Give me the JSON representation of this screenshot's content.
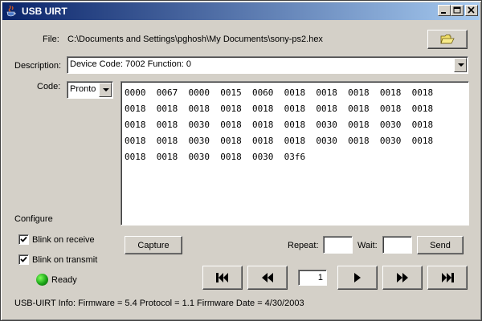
{
  "window": {
    "title": "USB UIRT",
    "minimize": "_",
    "maximize": "□",
    "close": "×"
  },
  "file": {
    "label": "File:",
    "path": "C:\\Documents and Settings\\pghosh\\My Documents\\sony-ps2.hex",
    "browse_icon": "folder-icon"
  },
  "description": {
    "label": "Description:",
    "value": "Device Code: 7002 Function: 0"
  },
  "code": {
    "label": "Code:",
    "format": "Pronto",
    "text": "0000  0067  0000  0015  0060  0018  0018  0018  0018  0018\n0018  0018  0018  0018  0018  0018  0018  0018  0018  0018\n0018  0018  0030  0018  0018  0018  0030  0018  0030  0018\n0018  0018  0030  0018  0018  0018  0030  0018  0030  0018\n0018  0018  0030  0018  0030  03f6"
  },
  "configure": {
    "label": "Configure",
    "blink_receive": {
      "label": "Blink on receive",
      "checked": true
    },
    "blink_transmit": {
      "label": "Blink on transmit",
      "checked": true
    }
  },
  "status": {
    "text": "Ready",
    "color": "#1aa317"
  },
  "actions": {
    "capture": "Capture",
    "repeat_label": "Repeat:",
    "repeat_value": "",
    "wait_label": "Wait:",
    "wait_value": "",
    "send": "Send"
  },
  "navigation": {
    "page": "1",
    "icons": [
      "skip-first-icon",
      "rewind-icon",
      "play-icon",
      "fast-forward-icon",
      "skip-last-icon"
    ]
  },
  "info": {
    "text": "USB-UIRT Info: Firmware = 5.4 Protocol = 1.1 Firmware Date = 4/30/2003"
  }
}
